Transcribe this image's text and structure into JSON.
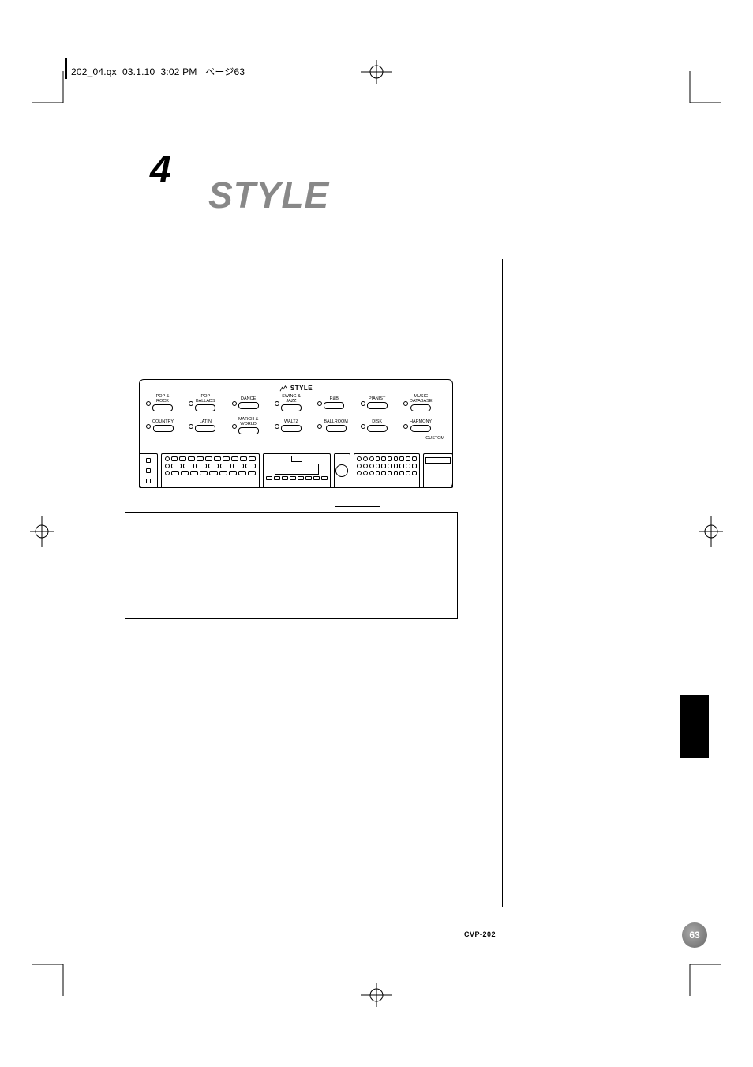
{
  "slug": {
    "file": "202_04.qx",
    "date": "03.1.10",
    "time": "3:02 PM",
    "jp": "ページ63"
  },
  "chapter": {
    "number": "4",
    "title": "STYLE"
  },
  "panel": {
    "heading": "STYLE",
    "row1": [
      {
        "l1": "POP &",
        "l2": "ROCK"
      },
      {
        "l1": "POP",
        "l2": "BALLADS"
      },
      {
        "l1": "",
        "l2": "DANCE"
      },
      {
        "l1": "SWING &",
        "l2": "JAZZ"
      },
      {
        "l1": "",
        "l2": "R&B"
      },
      {
        "l1": "",
        "l2": "PIANIST"
      },
      {
        "l1": "MUSIC",
        "l2": "DATABASE"
      }
    ],
    "row2": [
      {
        "l1": "",
        "l2": "COUNTRY"
      },
      {
        "l1": "",
        "l2": "LATIN"
      },
      {
        "l1": "MARCH &",
        "l2": "WORLD"
      },
      {
        "l1": "",
        "l2": "WALTZ"
      },
      {
        "l1": "",
        "l2": "BALLROOM"
      },
      {
        "l1": "",
        "l2": "DISK"
      },
      {
        "l1": "",
        "l2": "HARMONY"
      }
    ],
    "custom": "CUSTOM"
  },
  "footer": {
    "model": "CVP-202",
    "page": "63"
  }
}
